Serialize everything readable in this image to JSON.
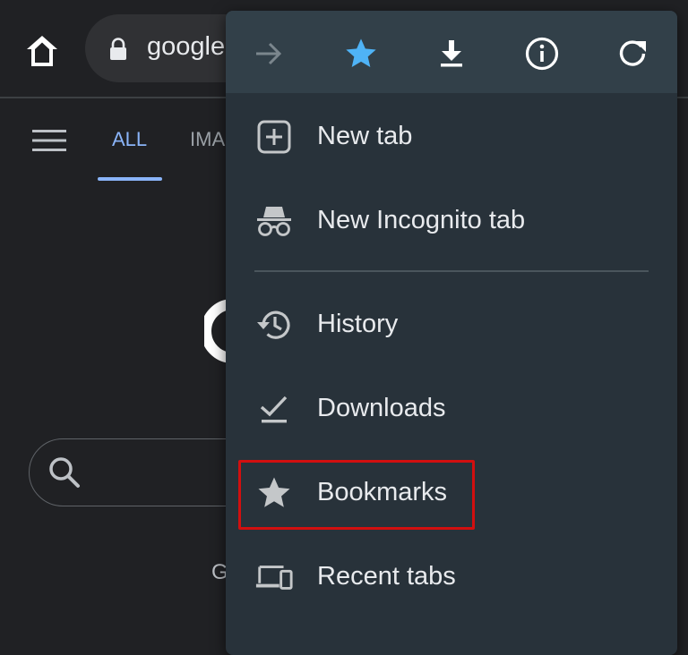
{
  "browser": {
    "url_text": "google",
    "icons": {
      "home": "home-icon",
      "lock": "lock-icon"
    }
  },
  "page": {
    "tabs": [
      {
        "label": "ALL",
        "active": true
      },
      {
        "label": "IMA",
        "active": false
      }
    ],
    "footer_text": "G",
    "icons": {
      "menu": "hamburger-menu-icon",
      "search": "search-icon"
    }
  },
  "menu": {
    "toolbar": [
      {
        "name": "forward",
        "icon": "arrow-forward-icon",
        "enabled": false
      },
      {
        "name": "bookmark",
        "icon": "star-icon",
        "active": true
      },
      {
        "name": "download",
        "icon": "download-icon"
      },
      {
        "name": "page-info",
        "icon": "info-icon"
      },
      {
        "name": "reload",
        "icon": "reload-icon"
      }
    ],
    "items": [
      {
        "label": "New tab",
        "icon": "add-box-icon"
      },
      {
        "label": "New Incognito tab",
        "icon": "incognito-icon"
      },
      {
        "label": "History",
        "icon": "history-icon"
      },
      {
        "label": "Downloads",
        "icon": "download-done-icon"
      },
      {
        "label": "Bookmarks",
        "icon": "star-icon",
        "highlighted": true
      },
      {
        "label": "Recent tabs",
        "icon": "devices-icon"
      }
    ]
  },
  "colors": {
    "accent_blue": "#8ab4f8",
    "star_blue": "#4fb3f6",
    "highlight_red": "#d20f0f",
    "menu_bg": "#28323a",
    "toolbar_bg": "#324049"
  }
}
